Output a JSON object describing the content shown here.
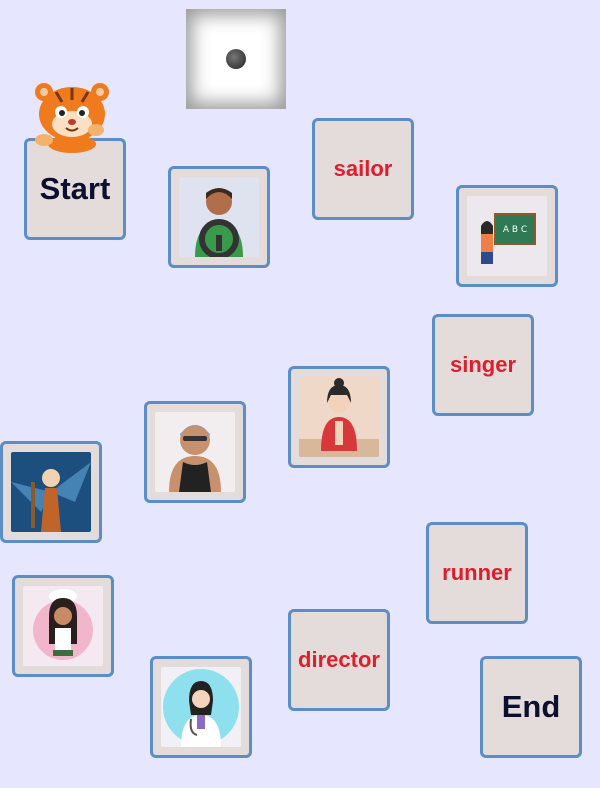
{
  "tiles": {
    "start": "Start",
    "end": "End",
    "sailor": "sailor",
    "singer": "singer",
    "runner": "runner",
    "director": "director"
  },
  "dice": {
    "value": 1
  },
  "colors": {
    "background": "#e6e6ff",
    "tile_fill": "#e3dcdb",
    "tile_border": "#5b8ec6",
    "word_text": "#dd1f2d",
    "endpoint_text": "#0d0f2e"
  },
  "icons": {
    "player_token": "tiger-mascot-icon",
    "die": "die-face-one-icon",
    "pictures": [
      "driver-picture",
      "teacher-picture",
      "student-picture",
      "swimmer-picture",
      "warrior-picture",
      "cook-picture",
      "doctor-picture"
    ]
  }
}
